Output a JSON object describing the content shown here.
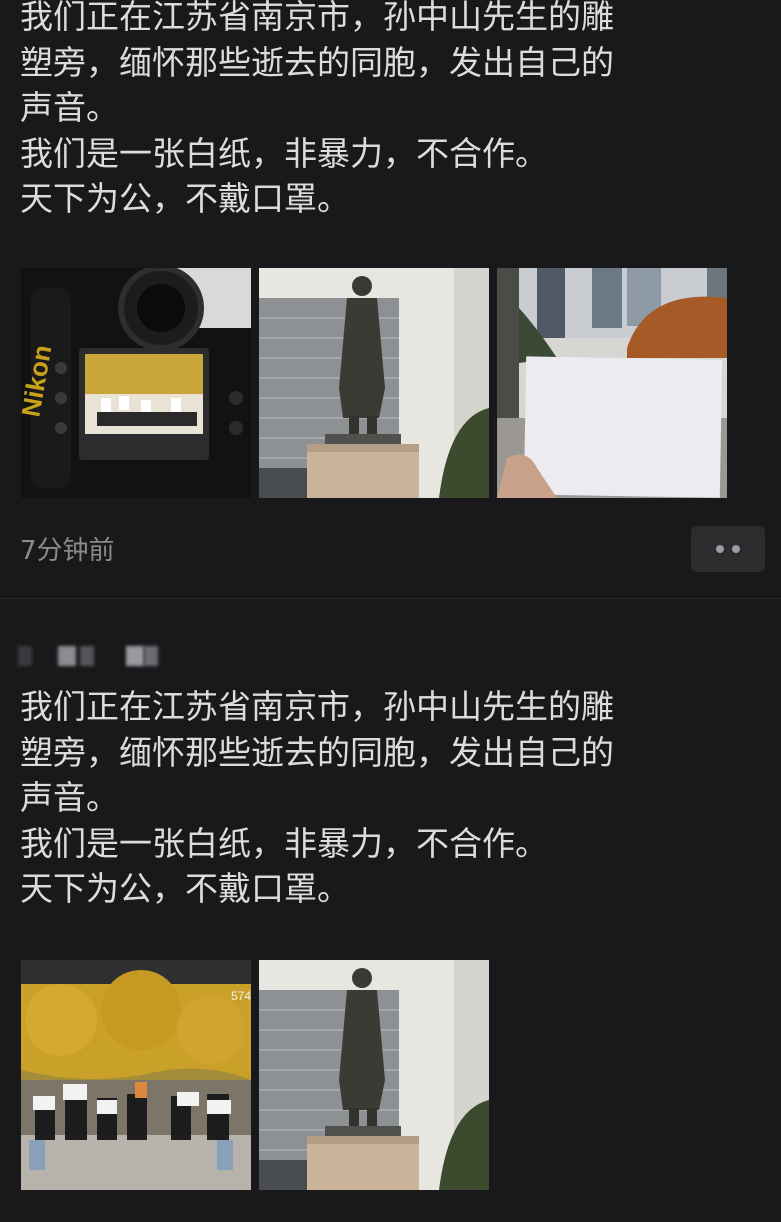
{
  "post1": {
    "lines": [
      "我们正在江苏省南京市，孙中山先生的雕",
      "塑旁，缅怀那些逝去的同胞，发出自己的",
      "声音。",
      "我们是一张白纸，非暴力，不合作。",
      "天下为公，不戴口罩。"
    ],
    "photos": [
      "camera-screen-photo",
      "sun-yat-sen-statue-photo",
      "blank-paper-photo"
    ],
    "camera_brand": "Nikon",
    "timestamp": "7分钟前"
  },
  "post2": {
    "lines": [
      "我们正在江苏省南京市，孙中山先生的雕",
      "塑旁，缅怀那些逝去的同胞，发出自己的",
      "声音。",
      "我们是一张白纸，非暴力，不合作。",
      "天下为公，不戴口罩。"
    ],
    "photos": [
      "protest-group-photo",
      "sun-yat-sen-statue-photo"
    ],
    "photo_badge": "574"
  }
}
